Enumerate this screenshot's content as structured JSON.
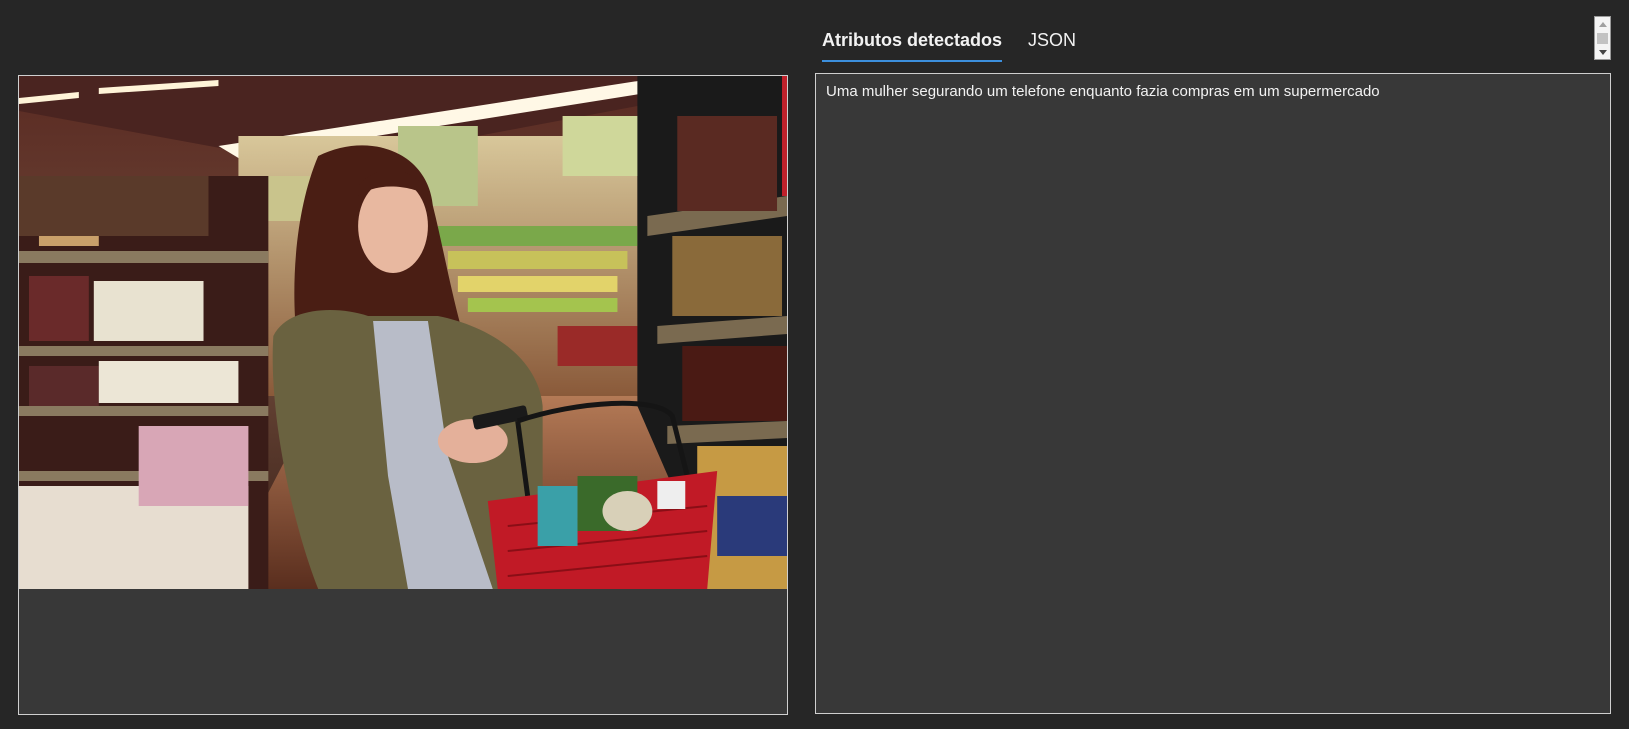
{
  "tabs": [
    {
      "label": "Atributos detectados",
      "active": true
    },
    {
      "label": "JSON",
      "active": false
    }
  ],
  "result": {
    "caption": "Uma mulher segurando um telefone enquanto fazia compras em um supermercado"
  },
  "colors": {
    "accent": "#3c8fdd",
    "background": "#262626",
    "panel": "#383838",
    "border": "#cfcfcf"
  },
  "icons": {
    "scroll_up": "chevron-up-icon",
    "scroll_down": "chevron-down-icon"
  }
}
